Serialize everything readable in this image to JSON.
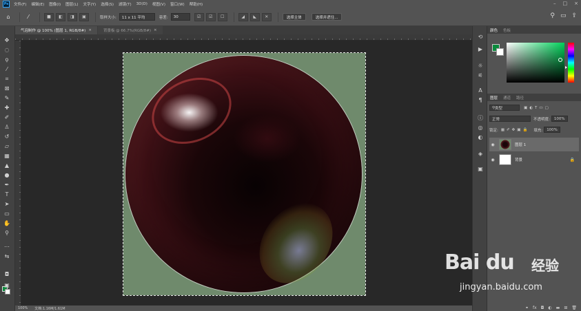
{
  "app": {
    "logo": "Ps"
  },
  "menubar": {
    "items": [
      "文件(F)",
      "编辑(E)",
      "图像(I)",
      "图层(L)",
      "文字(Y)",
      "选择(S)",
      "滤镜(T)",
      "3D(D)",
      "视图(V)",
      "窗口(W)",
      "帮助(H)"
    ],
    "window_controls": [
      "–",
      "□",
      "×"
    ]
  },
  "options": {
    "sample_size_label": "取样大小:",
    "sample_size_value": "11 x 11 平均",
    "tolerance_label": "容差:",
    "tolerance_value": "30",
    "select_subject": "选择主体",
    "select_and_mask": "选择并遮住..."
  },
  "tabs": [
    {
      "label": "气泡制作 @ 100% (图层 1, RGB/8#)",
      "close": "×",
      "active": true
    },
    {
      "label": "背景板 @ 66.7%(RGB/8#)",
      "close": "×",
      "active": false
    }
  ],
  "status": {
    "zoom": "100%",
    "doc": "文档:1.16M/1.61M"
  },
  "color_panel": {
    "tabs": [
      "颜色",
      "色板"
    ],
    "foreground": "#0b8a3c",
    "background": "#ffffff"
  },
  "layers_panel": {
    "tabs": [
      "图层",
      "通道",
      "路径"
    ],
    "filter_kind": "类型",
    "blend_mode": "正常",
    "opacity_label": "不透明度:",
    "opacity_value": "100%",
    "lock_label": "锁定:",
    "fill_label": "填充:",
    "fill_value": "100%",
    "layers": [
      {
        "name": "图层 1",
        "selected": true
      },
      {
        "name": "背景",
        "selected": false
      }
    ]
  },
  "watermark": {
    "brand": "Bai du",
    "product": "经验",
    "url": "jingyan.baidu.com"
  }
}
